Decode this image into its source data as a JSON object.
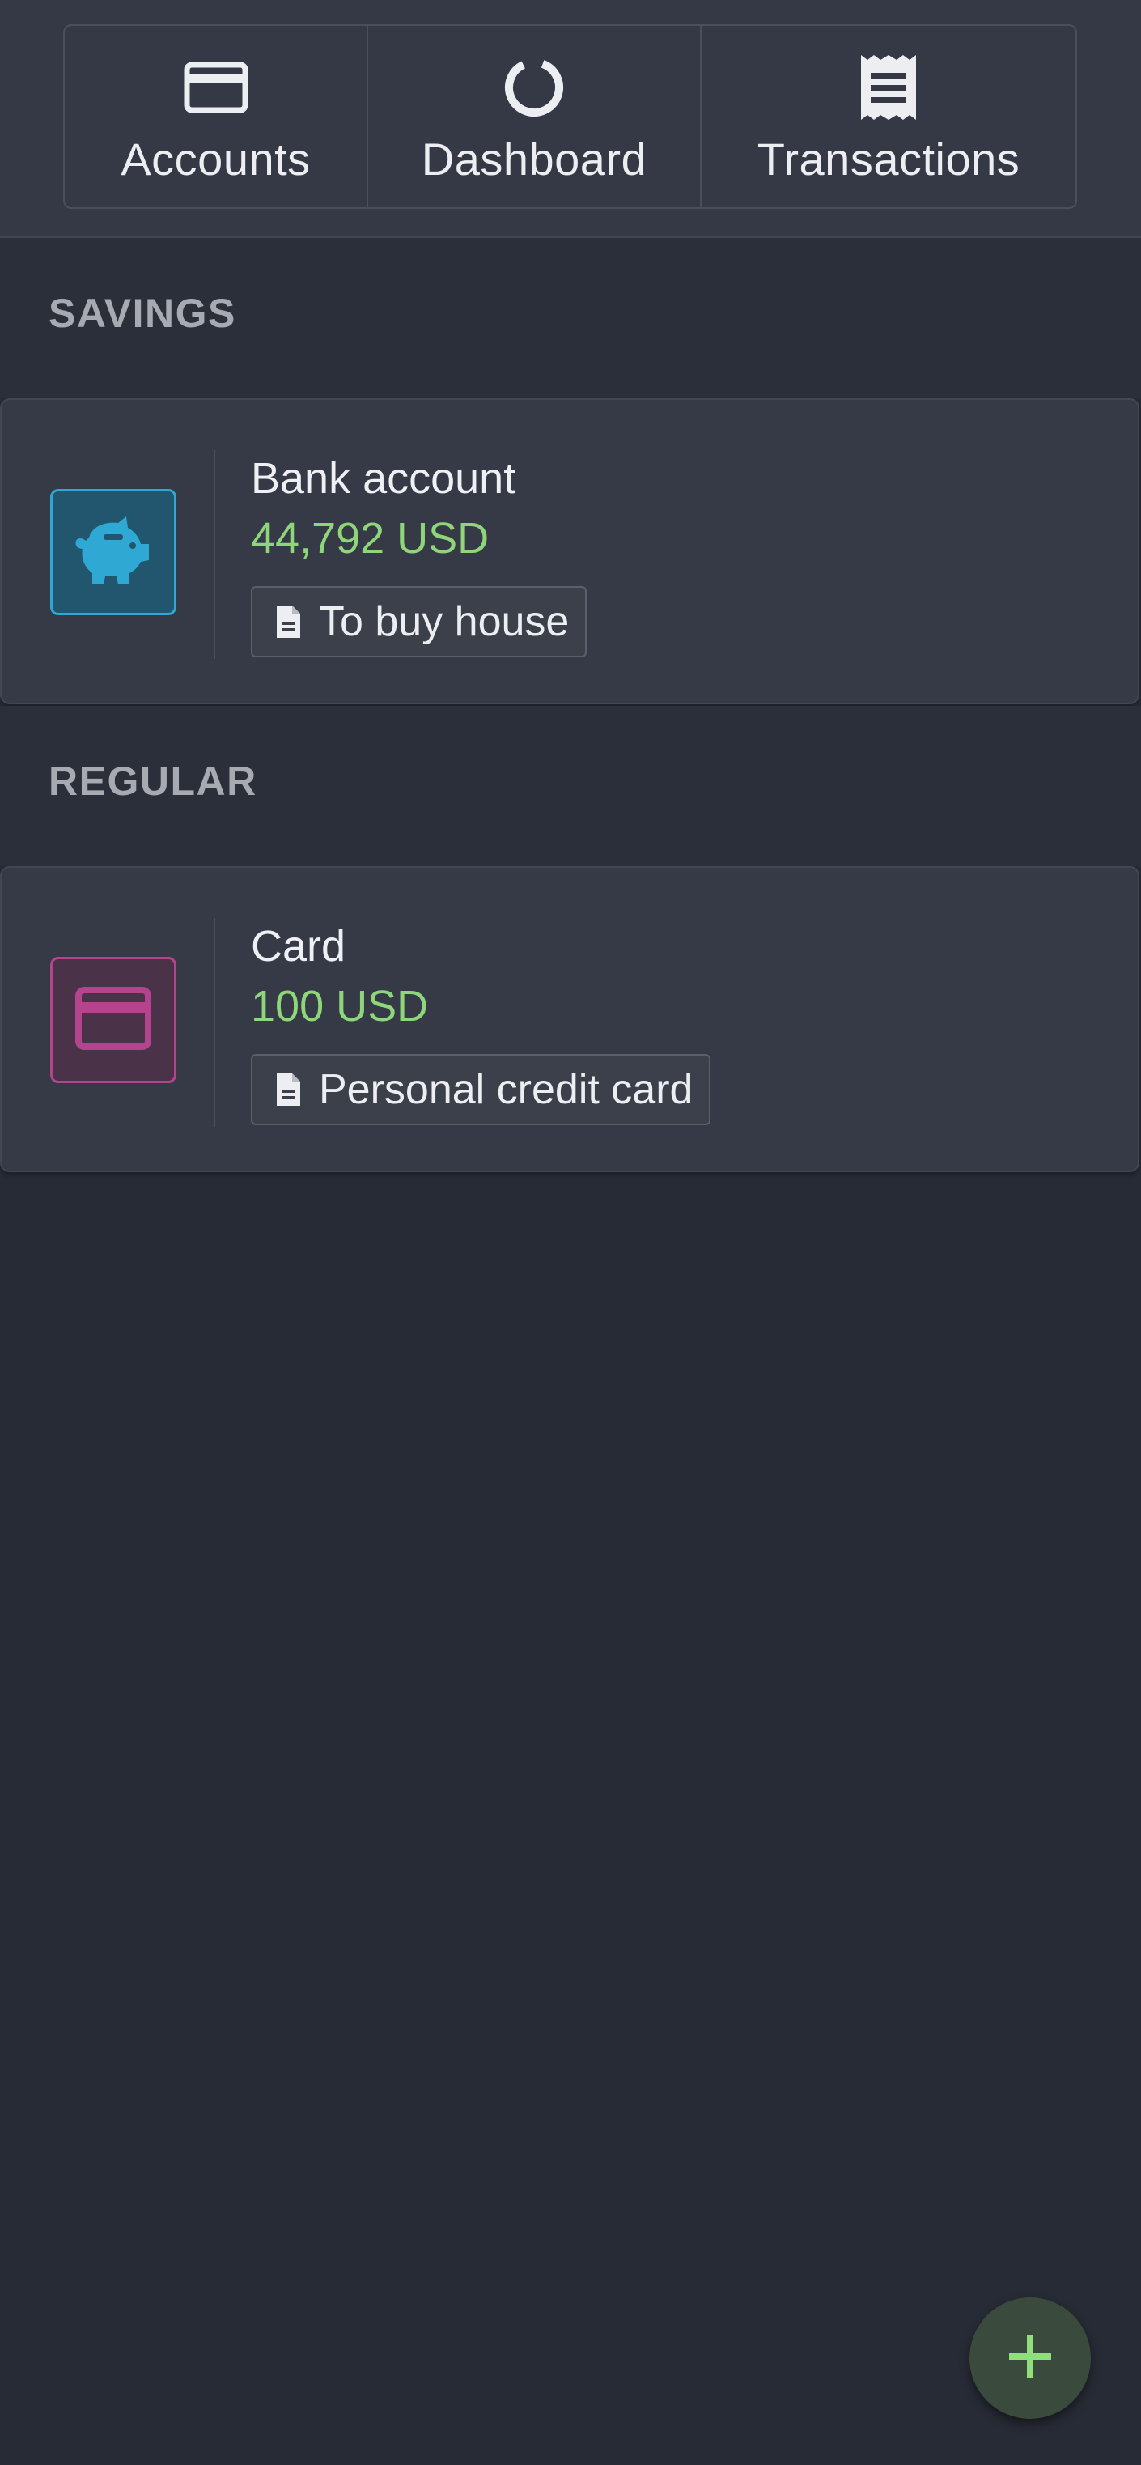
{
  "nav": {
    "tabs": [
      {
        "label": "Accounts",
        "icon": "credit-card-icon"
      },
      {
        "label": "Dashboard",
        "icon": "donut-chart-icon"
      },
      {
        "label": "Transactions",
        "icon": "receipt-icon"
      }
    ]
  },
  "sections": [
    {
      "title": "SAVINGS",
      "accounts": [
        {
          "name": "Bank account",
          "balance": "44,792 USD",
          "note": "To buy house",
          "icon": "piggy-bank-icon",
          "icon_color": "#2fa9d3"
        }
      ]
    },
    {
      "title": "REGULAR",
      "accounts": [
        {
          "name": "Card",
          "balance": "100 USD",
          "note": "Personal credit card",
          "icon": "credit-card-icon",
          "icon_color": "#b5448f"
        }
      ]
    }
  ],
  "fab": {
    "icon": "plus-icon"
  },
  "colors": {
    "background": "#272b35",
    "balance": "#8fd67a",
    "fab_plus": "#8fe07a"
  }
}
